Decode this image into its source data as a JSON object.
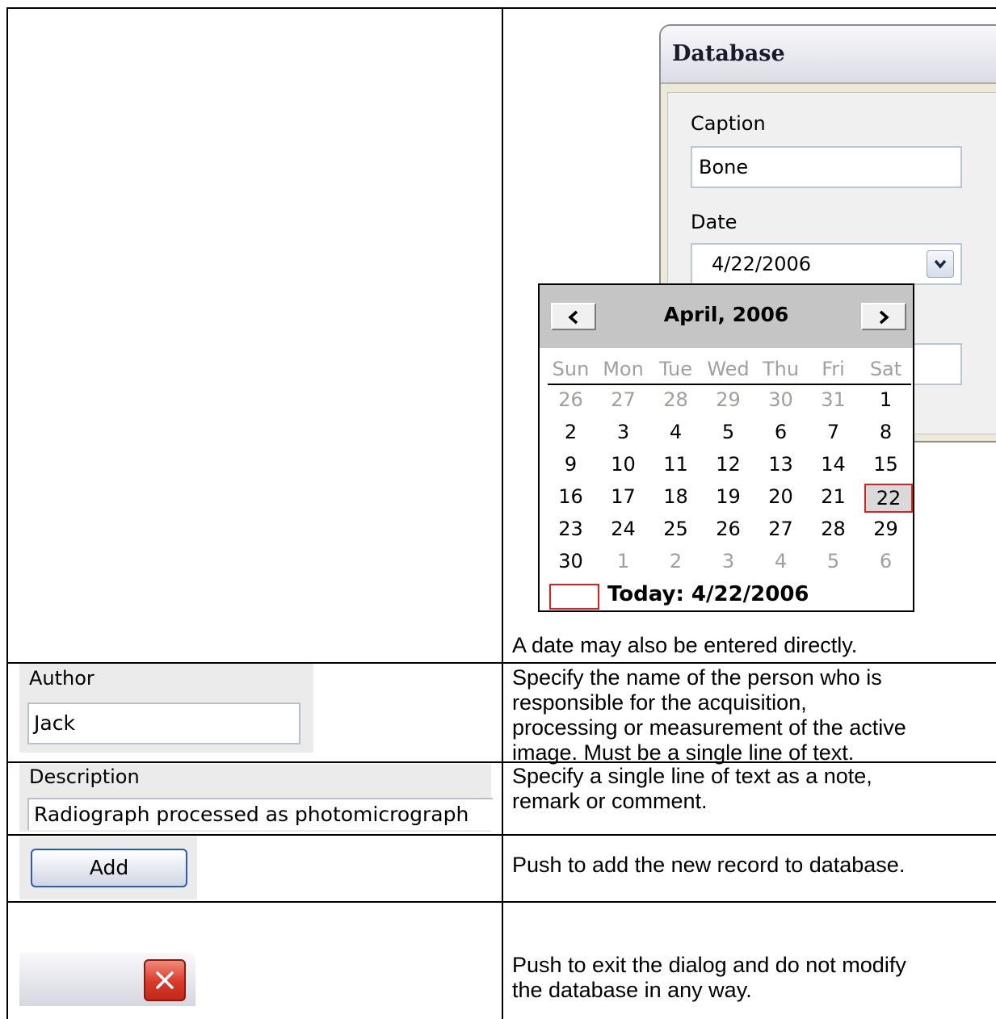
{
  "rows": {
    "row1_desc": "A date may also be entered directly.",
    "row2_desc_lines": [
      "Specify the name of the person who is",
      "responsible for the acquisition,",
      "processing or measurement of the active",
      "image. Must be a single line of text."
    ],
    "row3_desc_lines": [
      "Specify a single line of text as a note,",
      "remark or comment."
    ],
    "row4_desc": "Push to add the new record to database.",
    "row5_desc_lines": [
      "Push to exit the dialog and do not modify",
      "the database in any way."
    ]
  },
  "dialog": {
    "title": "Database",
    "caption_label": "Caption",
    "caption_value": "Bone",
    "date_label": "Date",
    "date_value": "4/22/2006"
  },
  "calendar": {
    "month_title": "April, 2006",
    "weekdays": [
      "Sun",
      "Mon",
      "Tue",
      "Wed",
      "Thu",
      "Fri",
      "Sat"
    ],
    "weeks": [
      [
        "26",
        "27",
        "28",
        "29",
        "30",
        "31",
        "1"
      ],
      [
        "2",
        "3",
        "4",
        "5",
        "6",
        "7",
        "8"
      ],
      [
        "9",
        "10",
        "11",
        "12",
        "13",
        "14",
        "15"
      ],
      [
        "16",
        "17",
        "18",
        "19",
        "20",
        "21",
        "22"
      ],
      [
        "23",
        "24",
        "25",
        "26",
        "27",
        "28",
        "29"
      ],
      [
        "30",
        "1",
        "2",
        "3",
        "4",
        "5",
        "6"
      ]
    ],
    "selected_day": "22",
    "today_text": "Today: 4/22/2006"
  },
  "author": {
    "label": "Author",
    "value": "Jack"
  },
  "description": {
    "label": "Description",
    "value": "Radiograph processed as photomicrograph"
  },
  "add_button": {
    "label": "Add"
  },
  "icons": {
    "prev": "chevron-left-icon",
    "next": "chevron-right-icon",
    "dropdown": "chevron-down-icon",
    "close": "close-icon"
  }
}
